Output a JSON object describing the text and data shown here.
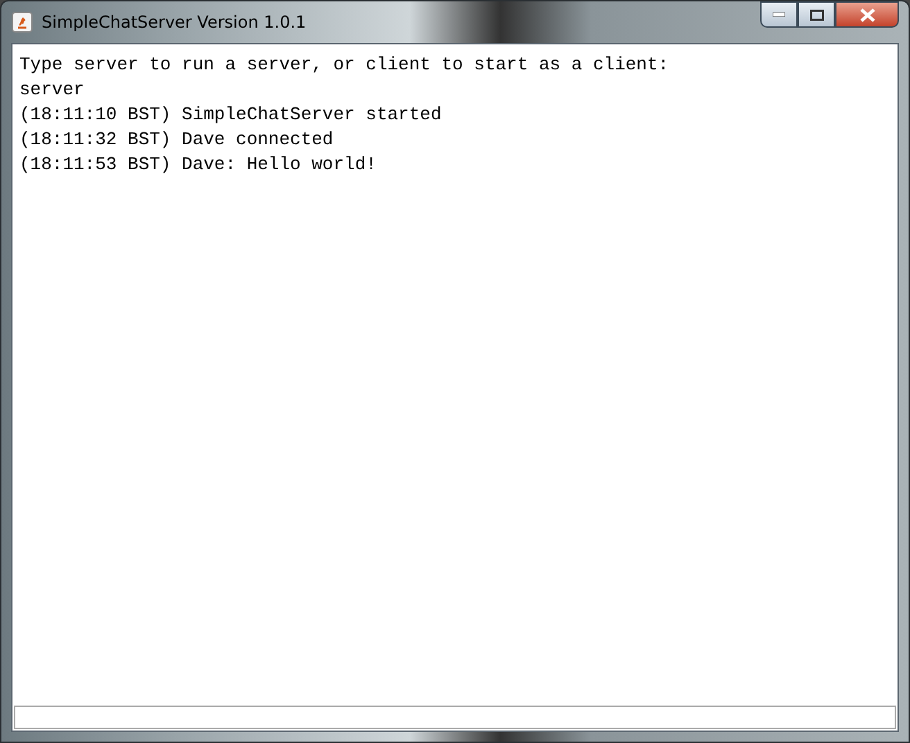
{
  "window": {
    "title": "SimpleChatServer Version 1.0.1"
  },
  "log": {
    "lines": [
      "Type server to run a server, or client to start as a client:",
      "server",
      "(18:11:10 BST) SimpleChatServer started",
      "(18:11:32 BST) Dave connected",
      "(18:11:53 BST) Dave: Hello world!"
    ]
  }
}
